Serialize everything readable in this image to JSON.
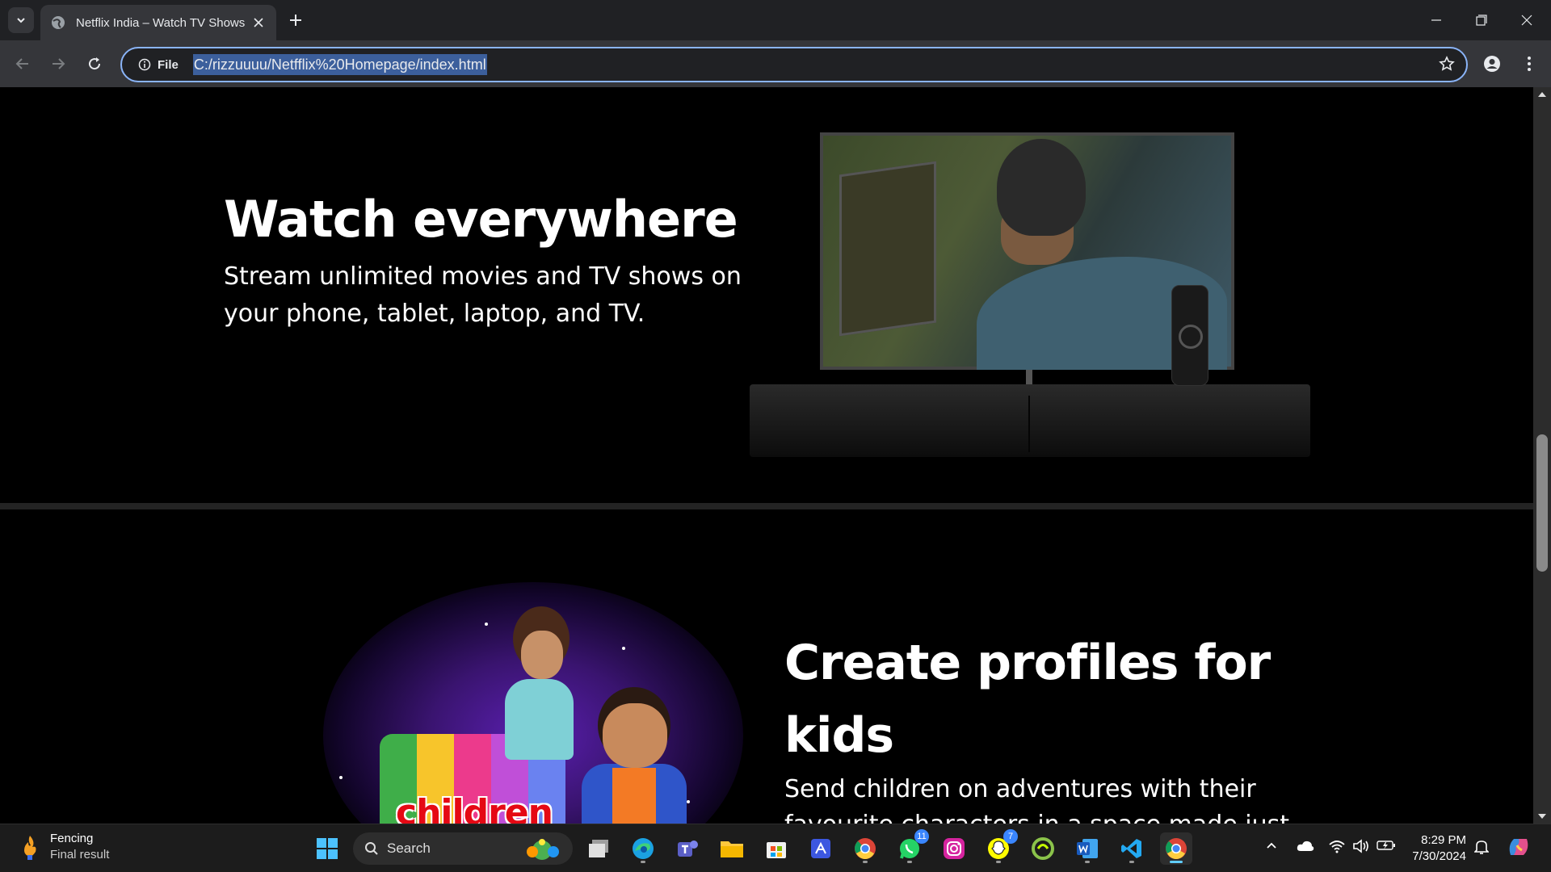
{
  "browser": {
    "tab_title": "Netflix India – Watch TV Shows Online",
    "address_chip": "File",
    "url": "C:/rizzuuuu/Netfflix%20Homepage/index.html"
  },
  "page": {
    "section1": {
      "heading": "Watch everywhere",
      "text": "Stream unlimited movies and TV shows on your phone, tablet, laptop, and TV."
    },
    "section2": {
      "heading": "Create profiles for kids",
      "text": "Send children on adventures with their favourite characters in a space made just",
      "image_label": "children"
    }
  },
  "taskbar": {
    "weather_title": "Fencing",
    "weather_subtitle": "Final result",
    "search_label": "Search",
    "whatsapp_badge": "11",
    "snapchat_badge": "7",
    "time": "8:29 PM",
    "date": "7/30/2024"
  },
  "colors": {
    "accent": "#8ab4f8",
    "netflix_red": "#e50914",
    "taskbar_active": "#60cdff"
  }
}
